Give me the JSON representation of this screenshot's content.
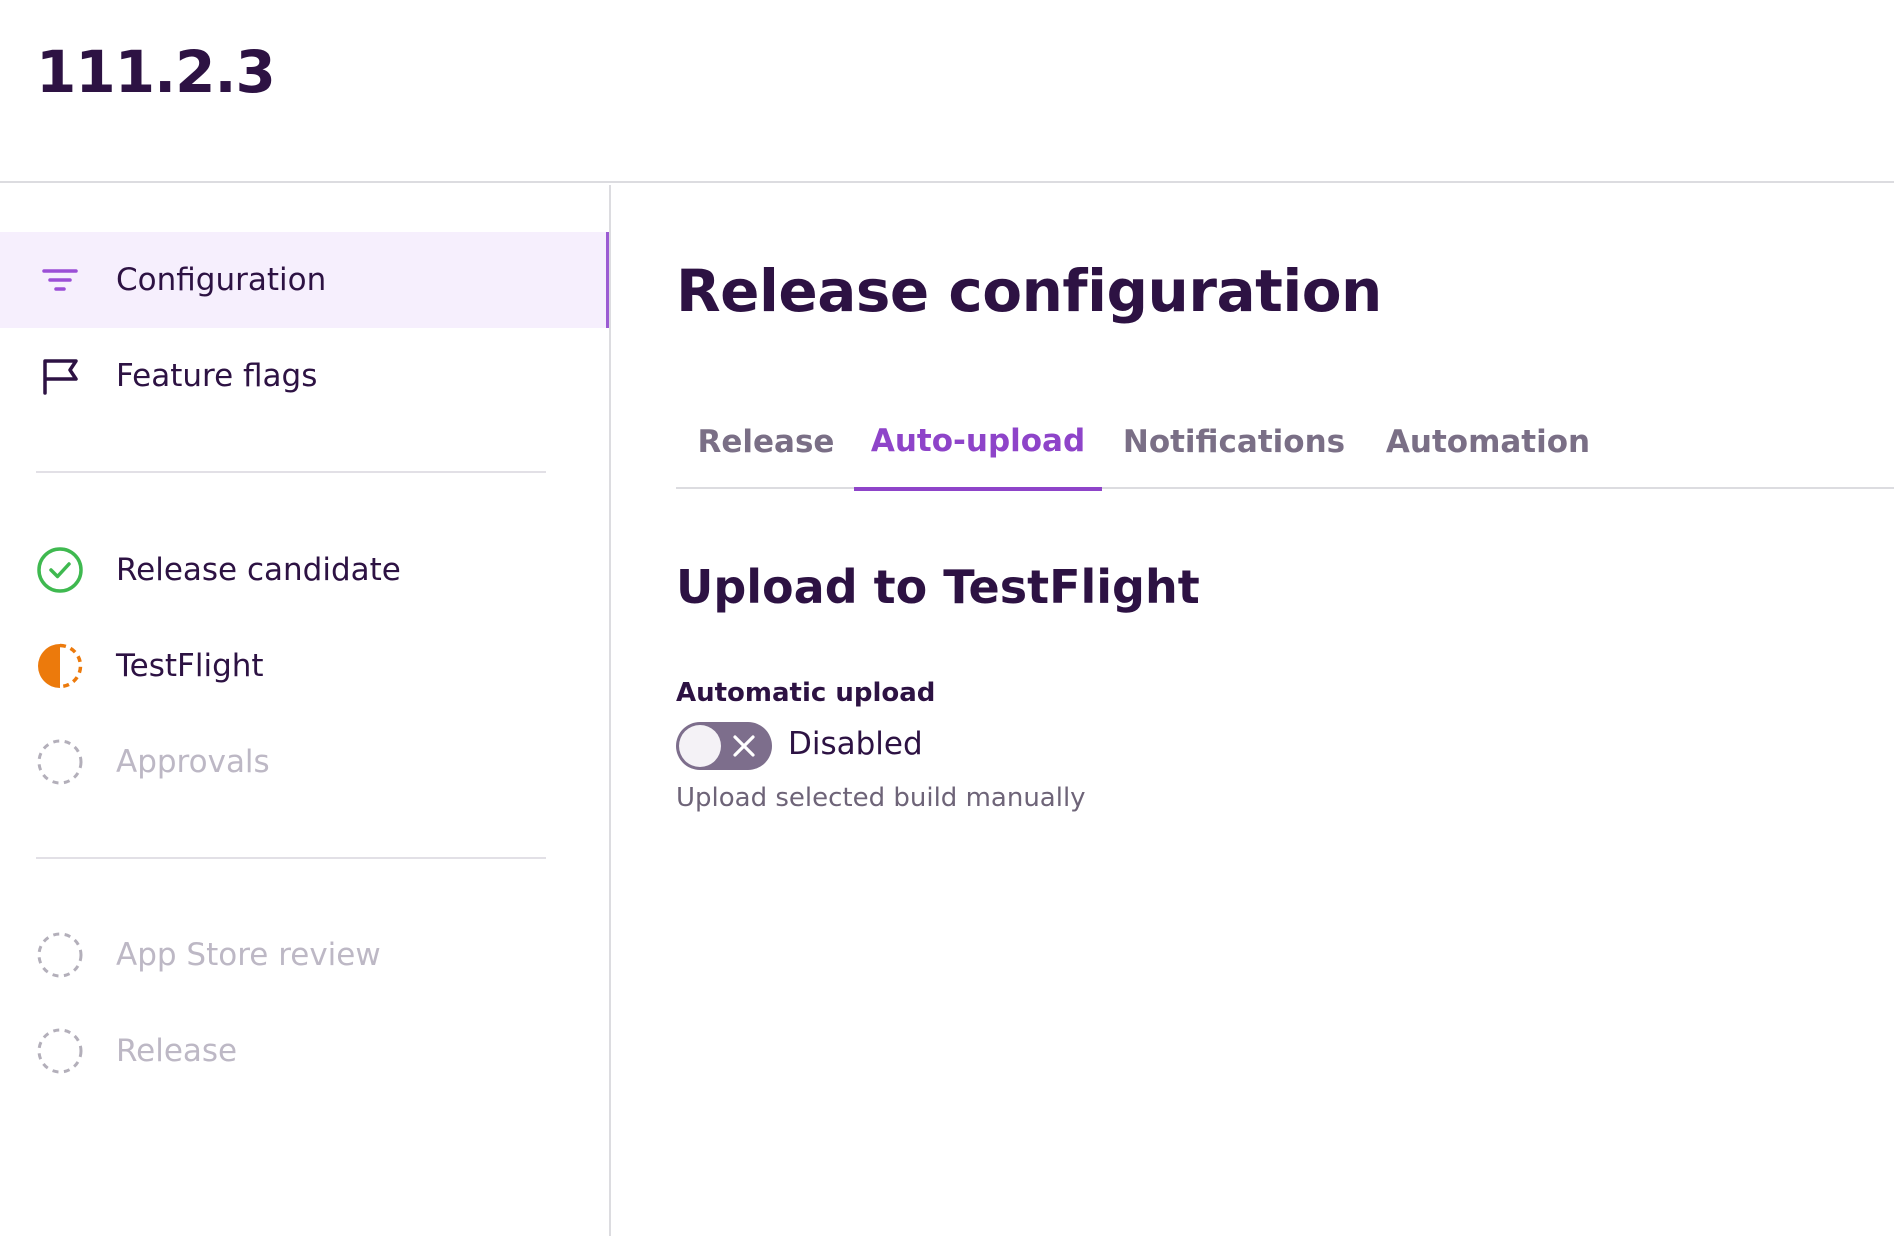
{
  "header": {
    "version": "111.2.3"
  },
  "sidebar": {
    "top_items": [
      {
        "label": "Configuration",
        "icon": "filter-lines-icon",
        "active": true
      },
      {
        "label": "Feature flags",
        "icon": "flag-icon",
        "active": false
      }
    ],
    "stages": [
      {
        "label": "Release candidate",
        "icon": "check-circle-icon",
        "status": "complete"
      },
      {
        "label": "TestFlight",
        "icon": "half-circle-icon",
        "status": "in-progress"
      },
      {
        "label": "Approvals",
        "icon": "dashed-circle-icon",
        "status": "pending"
      }
    ],
    "later_stages": [
      {
        "label": "App Store review",
        "icon": "dashed-circle-icon",
        "status": "pending"
      },
      {
        "label": "Release",
        "icon": "dashed-circle-icon",
        "status": "pending"
      }
    ]
  },
  "main": {
    "title": "Release configuration",
    "tabs": [
      {
        "label": "Release",
        "active": false
      },
      {
        "label": "Auto-upload",
        "active": true
      },
      {
        "label": "Notifications",
        "active": false
      },
      {
        "label": "Automation",
        "active": false
      }
    ],
    "section_title": "Upload to TestFlight",
    "automatic_upload": {
      "label": "Automatic upload",
      "enabled": false,
      "state_text": "Disabled",
      "help_text": "Upload selected build manually"
    }
  },
  "colors": {
    "primary_text": "#2d1243",
    "accent": "#8e44c9",
    "active_bg": "#f6effd",
    "success": "#3fb950",
    "warning": "#ec7a0c",
    "muted": "#bdb8c5"
  }
}
